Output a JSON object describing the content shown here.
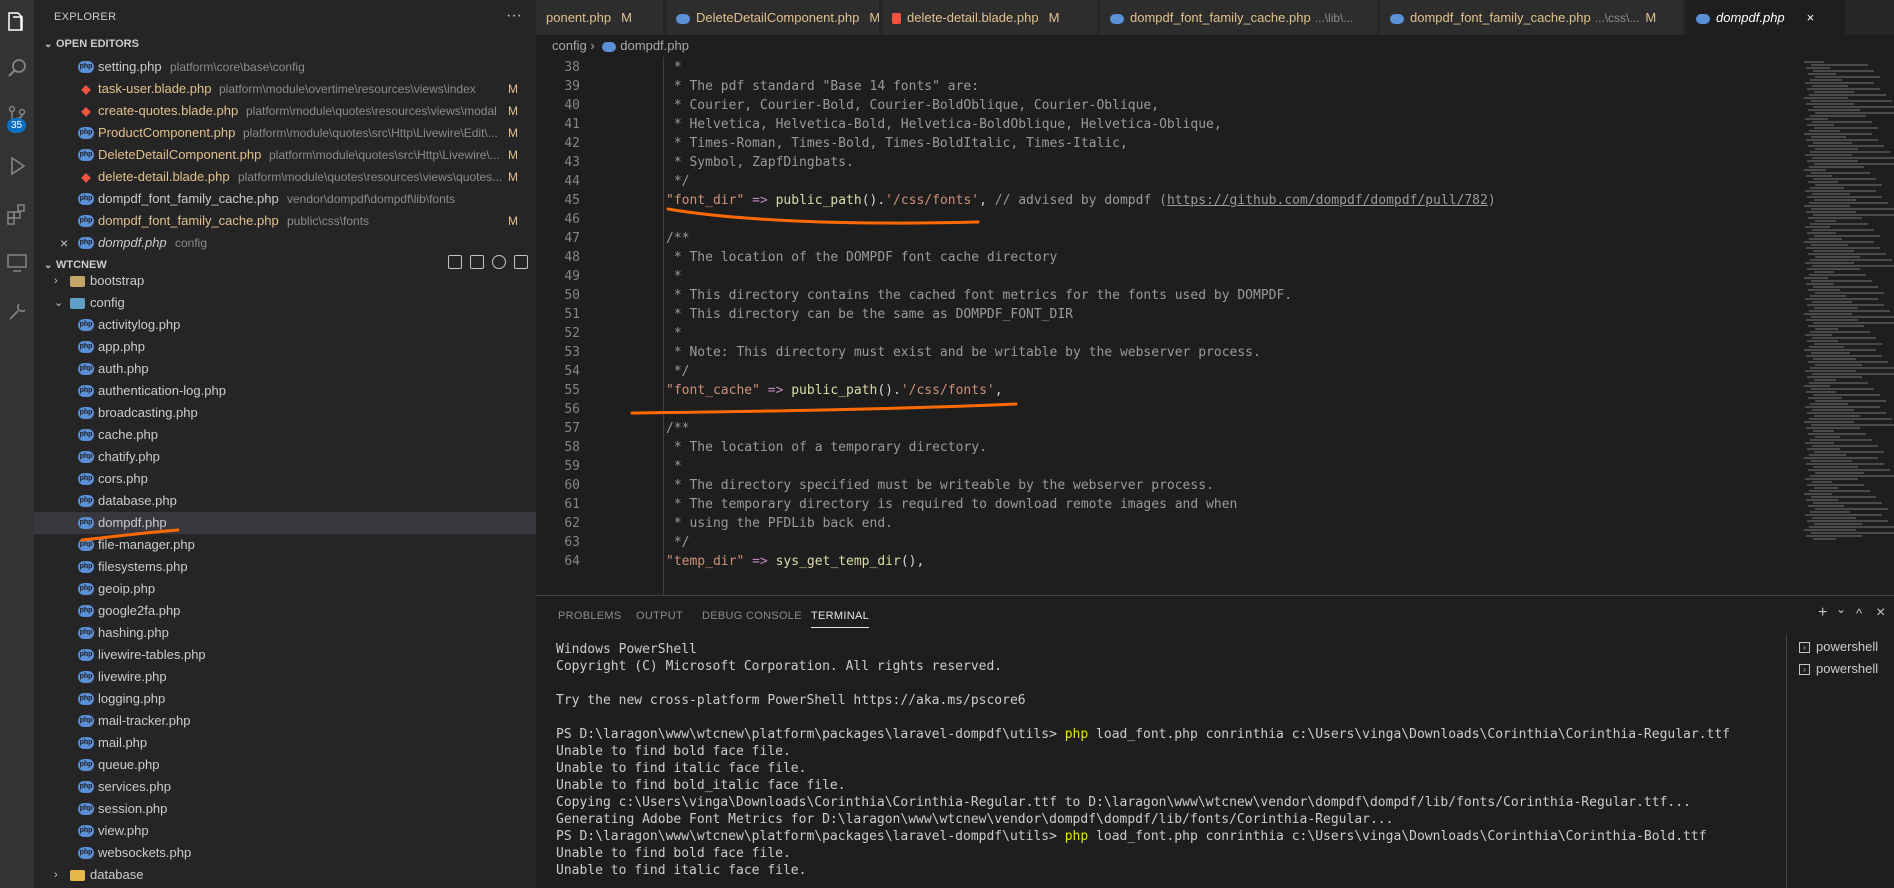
{
  "sidebar": {
    "title": "EXPLORER",
    "more": "···",
    "open_editors": {
      "heading": "OPEN EDITORS",
      "items": [
        {
          "name": "setting.php",
          "desc": "platform\\core\\base\\config",
          "flag": "",
          "type": "php"
        },
        {
          "name": "task-user.blade.php",
          "desc": "platform\\module\\overtime\\resources\\views\\index",
          "flag": "M",
          "type": "blade"
        },
        {
          "name": "create-quotes.blade.php",
          "desc": "platform\\module\\quotes\\resources\\views\\modal",
          "flag": "M",
          "type": "blade"
        },
        {
          "name": "ProductComponent.php",
          "desc": "platform\\module\\quotes\\src\\Http\\Livewire\\Edit\\...",
          "flag": "M",
          "type": "php"
        },
        {
          "name": "DeleteDetailComponent.php",
          "desc": "platform\\module\\quotes\\src\\Http\\Livewire\\...",
          "flag": "M",
          "type": "php"
        },
        {
          "name": "delete-detail.blade.php",
          "desc": "platform\\module\\quotes\\resources\\views\\quotes...",
          "flag": "M",
          "type": "blade"
        },
        {
          "name": "dompdf_font_family_cache.php",
          "desc": "vendor\\dompdf\\dompdf\\lib\\fonts",
          "flag": "",
          "type": "php"
        },
        {
          "name": "dompdf_font_family_cache.php",
          "desc": "public\\css\\fonts",
          "flag": "M",
          "type": "php"
        },
        {
          "name": "dompdf.php",
          "desc": "config",
          "flag": "",
          "type": "php",
          "active": true
        }
      ]
    },
    "workspace": {
      "heading": "WTCNEW",
      "folders": {
        "bootstrap": "bootstrap",
        "config": "config",
        "database": "database"
      },
      "files": [
        "activitylog.php",
        "app.php",
        "auth.php",
        "authentication-log.php",
        "broadcasting.php",
        "cache.php",
        "chatify.php",
        "cors.php",
        "database.php",
        "dompdf.php",
        "file-manager.php",
        "filesystems.php",
        "geoip.php",
        "google2fa.php",
        "hashing.php",
        "livewire-tables.php",
        "livewire.php",
        "logging.php",
        "mail-tracker.php",
        "mail.php",
        "queue.php",
        "services.php",
        "session.php",
        "view.php",
        "websockets.php"
      ]
    }
  },
  "tabs": [
    {
      "label": "ponent.php",
      "desc": "",
      "mod": "M",
      "type": "php"
    },
    {
      "label": "DeleteDetailComponent.php",
      "desc": "",
      "mod": "M",
      "type": "php"
    },
    {
      "label": "delete-detail.blade.php",
      "desc": "",
      "mod": "M",
      "type": "blade"
    },
    {
      "label": "dompdf_font_family_cache.php",
      "desc": "...\\lib\\...",
      "mod": "",
      "type": "php"
    },
    {
      "label": "dompdf_font_family_cache.php",
      "desc": "...\\css\\...",
      "mod": "M",
      "type": "php"
    },
    {
      "label": "dompdf.php",
      "desc": "",
      "mod": "",
      "type": "php",
      "active": true,
      "close": "×"
    }
  ],
  "breadcrumb": {
    "folder": "config",
    "separator": "›",
    "file": "dompdf.php"
  },
  "code": {
    "l38": {
      "n": "38",
      "t": " *"
    },
    "l39": {
      "n": "39",
      "t": " * The pdf standard \"Base 14 fonts\" are:"
    },
    "l40": {
      "n": "40",
      "t": " * Courier, Courier-Bold, Courier-BoldOblique, Courier-Oblique,"
    },
    "l41": {
      "n": "41",
      "t": " * Helvetica, Helvetica-Bold, Helvetica-BoldOblique, Helvetica-Oblique,"
    },
    "l42": {
      "n": "42",
      "t": " * Times-Roman, Times-Bold, Times-BoldItalic, Times-Italic,"
    },
    "l43": {
      "n": "43",
      "t": " * Symbol, ZapfDingbats."
    },
    "l44": {
      "n": "44",
      "t": " */"
    },
    "l45": {
      "n": "45",
      "key": "\"font_dir\"",
      "arrow": " => ",
      "fn": "public_path",
      "paren": "()",
      "dot": ".",
      "str": "'/css/fonts'",
      "comma": ",",
      "comment": " // advised by dompdf (",
      "url": "https://github.com/dompdf/dompdf/pull/782",
      "close": ")"
    },
    "l46": {
      "n": "46",
      "t": ""
    },
    "l47": {
      "n": "47",
      "t": "/**"
    },
    "l48": {
      "n": "48",
      "t": " * The location of the DOMPDF font cache directory"
    },
    "l49": {
      "n": "49",
      "t": " *"
    },
    "l50": {
      "n": "50",
      "t": " * This directory contains the cached font metrics for the fonts used by DOMPDF."
    },
    "l51": {
      "n": "51",
      "t": " * This directory can be the same as DOMPDF_FONT_DIR"
    },
    "l52": {
      "n": "52",
      "t": " *"
    },
    "l53": {
      "n": "53",
      "t": " * Note: This directory must exist and be writable by the webserver process."
    },
    "l54": {
      "n": "54",
      "t": " */"
    },
    "l55": {
      "n": "55",
      "key": "\"font_cache\"",
      "arrow": " => ",
      "fn": "public_path",
      "paren": "()",
      "dot": ".",
      "str": "'/css/fonts'",
      "comma": ","
    },
    "l56": {
      "n": "56",
      "t": ""
    },
    "l57": {
      "n": "57",
      "t": "/**"
    },
    "l58": {
      "n": "58",
      "t": " * The location of a temporary directory."
    },
    "l59": {
      "n": "59",
      "t": " *"
    },
    "l60": {
      "n": "60",
      "t": " * The directory specified must be writeable by the webserver process."
    },
    "l61": {
      "n": "61",
      "t": " * The temporary directory is required to download remote images and when"
    },
    "l62": {
      "n": "62",
      "t": " * using the PFDLib back end."
    },
    "l63": {
      "n": "63",
      "t": " */"
    },
    "l64": {
      "n": "64",
      "key": "\"temp_dir\"",
      "arrow": " => ",
      "fn": "sys_get_temp_dir",
      "paren": "()",
      "comma": ","
    }
  },
  "panel": {
    "tabs": {
      "problems": "PROBLEMS",
      "output": "OUTPUT",
      "debug": "DEBUG CONSOLE",
      "terminal": "TERMINAL"
    },
    "controls": {
      "add": "+",
      "chevron": "⌄",
      "maximize": "^",
      "close": "×"
    },
    "terminal_list": [
      "powershell",
      "powershell"
    ],
    "terminal": {
      "t1": "Windows PowerShell",
      "t2": "Copyright (C) Microsoft Corporation. All rights reserved.",
      "t3": "Try the new cross-platform PowerShell https://aka.ms/pscore6",
      "t4_prompt": "PS D:\\laragon\\www\\wtcnew\\platform\\packages\\laravel-dompdf\\utils> ",
      "t4_cmd": "php",
      "t4_args": " load_font.php conrinthia c:\\Users\\vinga\\Downloads\\Corinthia\\Corinthia-Regular.ttf",
      "t5": "Unable to find bold face file.",
      "t6": "Unable to find italic face file.",
      "t7": "Unable to find bold_italic face file.",
      "t8": "Copying c:\\Users\\vinga\\Downloads\\Corinthia\\Corinthia-Regular.ttf to D:\\laragon\\www\\wtcnew\\vendor\\dompdf\\dompdf/lib/fonts/Corinthia-Regular.ttf...",
      "t9": "Generating Adobe Font Metrics for D:\\laragon\\www\\wtcnew\\vendor\\dompdf\\dompdf/lib/fonts/Corinthia-Regular...",
      "t10_prompt": "PS D:\\laragon\\www\\wtcnew\\platform\\packages\\laravel-dompdf\\utils> ",
      "t10_cmd": "php",
      "t10_args": " load_font.php conrinthia c:\\Users\\vinga\\Downloads\\Corinthia\\Corinthia-Bold.ttf",
      "t11": "Unable to find bold face file.",
      "t12": "Unable to find italic face file."
    }
  },
  "activity": {
    "scm_badge": "35"
  },
  "colors": {
    "annotation": "#ff6a00",
    "modified": "#e2c08d",
    "accent": "#0e70c0"
  }
}
